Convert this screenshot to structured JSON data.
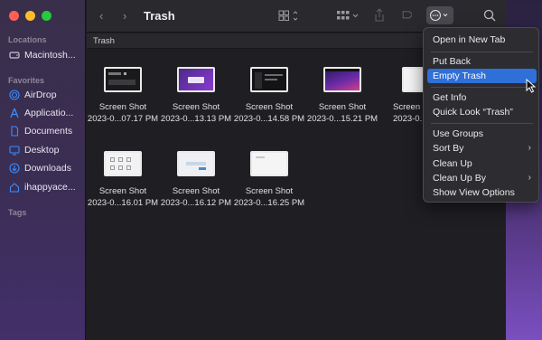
{
  "sidebar": {
    "locations_label": "Locations",
    "favorites_label": "Favorites",
    "tags_label": "Tags",
    "items": [
      {
        "label": "Macintosh...",
        "icon": "disk-icon"
      },
      {
        "label": "AirDrop",
        "icon": "airdrop-icon"
      },
      {
        "label": "Applicatio...",
        "icon": "applications-icon"
      },
      {
        "label": "Documents",
        "icon": "document-icon"
      },
      {
        "label": "Desktop",
        "icon": "desktop-icon"
      },
      {
        "label": "Downloads",
        "icon": "downloads-icon"
      },
      {
        "label": "ihappyace...",
        "icon": "home-icon"
      }
    ]
  },
  "toolbar": {
    "title": "Trash"
  },
  "pathbar": {
    "label": "Trash"
  },
  "files": [
    {
      "line1": "Screen Shot",
      "line2": "2023-0...07.17 PM",
      "style": "dark"
    },
    {
      "line1": "Screen Shot",
      "line2": "2023-0...13.13 PM",
      "style": "purple"
    },
    {
      "line1": "Screen Shot",
      "line2": "2023-0...14.58 PM",
      "style": "code"
    },
    {
      "line1": "Screen Shot",
      "line2": "2023-0...15.21 PM",
      "style": "wallpaper"
    },
    {
      "line1": "Screen Shot",
      "line2": "2023-0...",
      "style": "light"
    },
    {
      "line1": "Screen Shot",
      "line2": "2023-0...16.01 PM",
      "style": "grid"
    },
    {
      "line1": "Screen Shot",
      "line2": "2023-0...16.12 PM",
      "style": "dialog"
    },
    {
      "line1": "Screen Shot",
      "line2": "2023-0...16.25 PM",
      "style": "blank"
    }
  ],
  "menu": {
    "open_new_tab": "Open in New Tab",
    "put_back": "Put Back",
    "empty_trash": "Empty Trash",
    "get_info": "Get Info",
    "quick_look": "Quick Look “Trash”",
    "use_groups": "Use Groups",
    "sort_by": "Sort By",
    "clean_up": "Clean Up",
    "clean_up_by": "Clean Up By",
    "show_view_options": "Show View Options"
  },
  "colors": {
    "accent": "#2f6fd8",
    "close": "#ff5f57",
    "minimize": "#febc2e",
    "zoom": "#28c840"
  }
}
